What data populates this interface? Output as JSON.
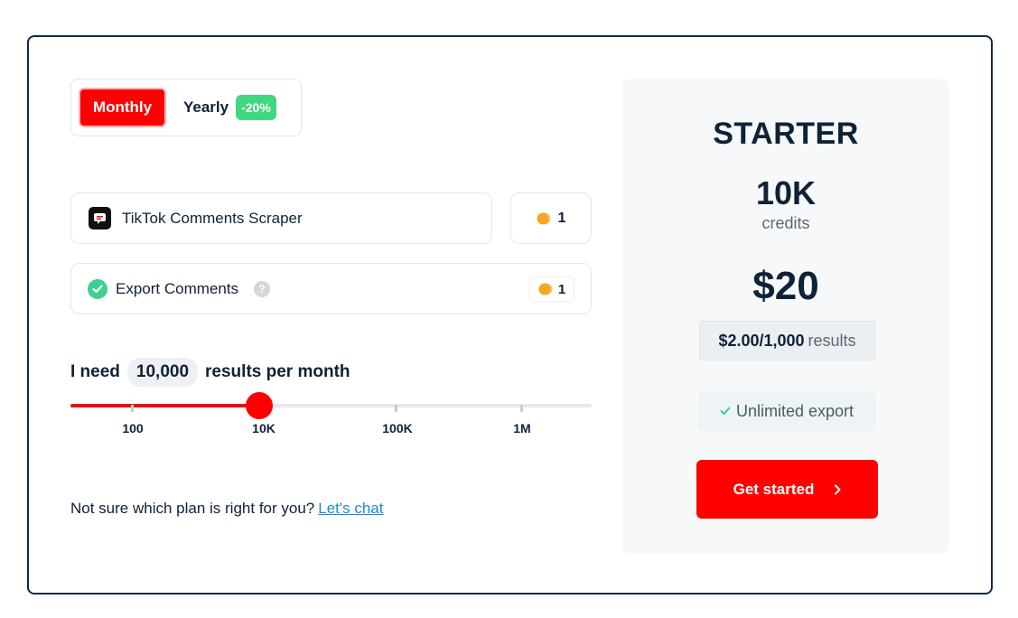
{
  "billing": {
    "monthly_label": "Monthly",
    "yearly_label": "Yearly",
    "yearly_discount": "-20%",
    "selected": "Monthly"
  },
  "actor": {
    "name": "TikTok Comments Scraper",
    "credits": "1"
  },
  "export": {
    "label": "Export Comments",
    "help": "?",
    "credits": "1"
  },
  "usage": {
    "prefix": "I need",
    "value": "10,000",
    "suffix": "results per month",
    "slider_ticks": [
      "100",
      "10K",
      "100K",
      "1M"
    ],
    "slider_value_fraction": 0.362
  },
  "footer": {
    "question": "Not sure which plan is right for you?",
    "link": "Let's chat"
  },
  "plan": {
    "name": "STARTER",
    "credits": "10K",
    "credits_unit": "credits",
    "price": "$20",
    "price_per_amount": "$2.00/1,000",
    "price_per_unit": "results",
    "feature": "Unlimited export",
    "cta": "Get started",
    "cta_icon": "chevron-right-icon"
  },
  "colors": {
    "accent": "#ff0000",
    "discount": "#3fd77f",
    "text": "#0f2236",
    "link": "#1b8ad6",
    "coin": "#f5a623"
  }
}
